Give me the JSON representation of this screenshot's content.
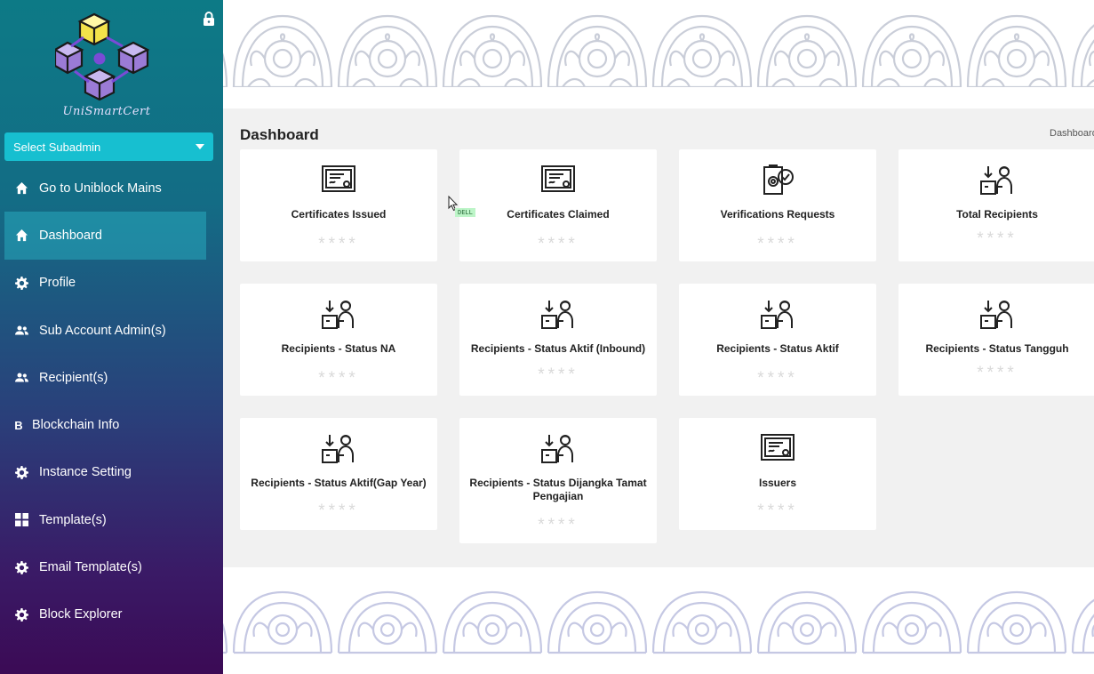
{
  "sidebar": {
    "logo_text": "UniSmartCert",
    "select_subadmin": "Select Subadmin",
    "items": [
      {
        "label": "Go to Uniblock Mains",
        "icon": "home-icon"
      },
      {
        "label": "Dashboard",
        "icon": "home-icon",
        "active": true
      },
      {
        "label": "Profile",
        "icon": "gear-icon"
      },
      {
        "label": "Sub Account Admin(s)",
        "icon": "users-icon"
      },
      {
        "label": "Recipient(s)",
        "icon": "users-icon"
      },
      {
        "label": "Blockchain Info",
        "icon": "b-letter-icon"
      },
      {
        "label": "Instance Setting",
        "icon": "gear-icon"
      },
      {
        "label": "Template(s)",
        "icon": "grid-icon"
      },
      {
        "label": "Email Template(s)",
        "icon": "gear-icon"
      },
      {
        "label": "Block Explorer",
        "icon": "gear-icon"
      }
    ]
  },
  "header": {
    "title": "Dashboard",
    "breadcrumb": "Dashboard"
  },
  "cards": [
    {
      "label": "Certificates Issued",
      "value": "****",
      "icon": "certificate-icon"
    },
    {
      "label": "Certificates Claimed",
      "value": "****",
      "icon": "certificate-icon"
    },
    {
      "label": "Verifications Requests",
      "value": "****",
      "icon": "verification-icon"
    },
    {
      "label": "Total Recipients",
      "value": "****",
      "icon": "recipient-icon"
    },
    {
      "label": "Recipients - Status NA",
      "value": "****",
      "icon": "recipient-icon"
    },
    {
      "label": "Recipients - Status Aktif (Inbound)",
      "value": "****",
      "icon": "recipient-icon"
    },
    {
      "label": "Recipients - Status Aktif",
      "value": "****",
      "icon": "recipient-icon"
    },
    {
      "label": "Recipients - Status Tangguh",
      "value": "****",
      "icon": "recipient-icon"
    },
    {
      "label": "Recipients - Status Aktif(Gap Year)",
      "value": "****",
      "icon": "recipient-icon"
    },
    {
      "label": "Recipients - Status Dijangka Tamat Pengajian",
      "value": "****",
      "icon": "recipient-icon"
    },
    {
      "label": "Issuers",
      "value": "****",
      "icon": "certificate-icon"
    }
  ],
  "overlay": {
    "cursor_tag": "DELL"
  },
  "colors": {
    "sidebar_top": "#0d7a86",
    "sidebar_bottom": "#3b0a55",
    "select_bg": "#17bfd0",
    "content_bg": "#f1f1f1"
  }
}
